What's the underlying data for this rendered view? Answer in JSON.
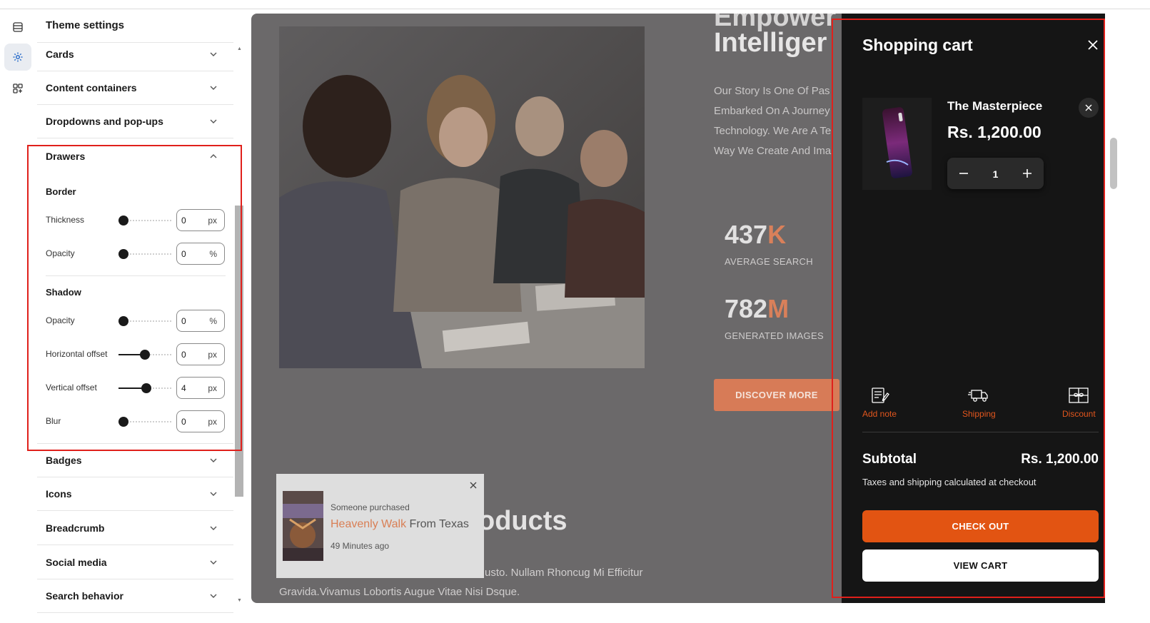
{
  "rail": {
    "items": [
      {
        "name": "sections",
        "active": false
      },
      {
        "name": "theme-settings",
        "active": true
      },
      {
        "name": "apps",
        "active": false
      }
    ]
  },
  "panel": {
    "title": "Theme settings",
    "groups_top": [
      "Cards",
      "Content containers",
      "Dropdowns and pop-ups"
    ],
    "drawers": {
      "title": "Drawers",
      "border": {
        "label": "Border",
        "thickness": {
          "label": "Thickness",
          "value": "0",
          "unit": "px",
          "level": 0
        },
        "opacity": {
          "label": "Opacity",
          "value": "0",
          "unit": "%",
          "level": 0
        }
      },
      "shadow": {
        "label": "Shadow",
        "opacity": {
          "label": "Opacity",
          "value": "0",
          "unit": "%",
          "level": 0
        },
        "horizontal": {
          "label": "Horizontal offset",
          "value": "0",
          "unit": "px",
          "level": 0.5
        },
        "vertical": {
          "label": "Vertical offset",
          "value": "4",
          "unit": "px",
          "level": 0.53
        },
        "blur": {
          "label": "Blur",
          "value": "0",
          "unit": "px",
          "level": 0
        }
      }
    },
    "groups_bottom": [
      "Badges",
      "Icons",
      "Breadcrumb",
      "Social media",
      "Search behavior"
    ]
  },
  "preview": {
    "hero_top_partial": "Empower",
    "hero_heading": "Intelliger",
    "hero_lines": [
      "Our Story Is One Of Pas",
      "Embarked On A Journey",
      "Technology. We Are A Te",
      "Way We Create And Ima"
    ],
    "stats": [
      {
        "number": "437",
        "suffix": "K",
        "label": "AVERAGE SEARCH"
      },
      {
        "number": "782",
        "suffix": "M",
        "label": "GENERATED IMAGES"
      }
    ],
    "discover_label": "DISCOVER MORE",
    "products_heading": "oducts",
    "body_line_1": "usto. Nullam Rhoncug Mi Efficitur",
    "body_line_2": "Gravida.Vivamus Lobortis Augue Vitae Nisi Dsque."
  },
  "toast": {
    "prefix": "Someone purchased",
    "product": "Heavenly Walk",
    "location": " From Texas",
    "time": "49 Minutes ago"
  },
  "cart": {
    "title": "Shopping cart",
    "item": {
      "name": "The Masterpiece",
      "price": "Rs. 1,200.00",
      "quantity": "1"
    },
    "tools": [
      {
        "label": "Add note",
        "icon": "note-icon"
      },
      {
        "label": "Shipping",
        "icon": "truck-icon"
      },
      {
        "label": "Discount",
        "icon": "gift-card-icon"
      }
    ],
    "subtotal_label": "Subtotal",
    "subtotal_value": "Rs. 1,200.00",
    "tax_note": "Taxes and shipping calculated at checkout",
    "checkout_label": "CHECK OUT",
    "viewcart_label": "VIEW CART"
  },
  "colors": {
    "accent_orange": "#e25412",
    "highlight_red": "#e0201b",
    "drawer_bg": "#151515",
    "overlay": "#6b696a"
  }
}
